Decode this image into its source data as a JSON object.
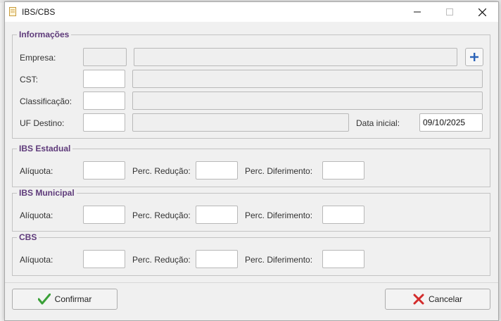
{
  "window": {
    "title": "IBS/CBS"
  },
  "informacoes": {
    "legend": "Informações",
    "empresa_label": "Empresa:",
    "empresa_code": "",
    "empresa_name": "",
    "cst_label": "CST:",
    "cst_code": "",
    "cst_desc": "",
    "classificacao_label": "Classificação:",
    "classificacao_code": "",
    "classificacao_desc": "",
    "uf_label": "UF Destino:",
    "uf_code": "",
    "uf_desc": "",
    "data_inicial_label": "Data inicial:",
    "data_inicial_value": "09/10/2025"
  },
  "ibs_estadual": {
    "legend": "IBS Estadual",
    "aliquota_label": "Alíquota:",
    "aliquota_value": "",
    "reducao_label": "Perc. Redução:",
    "reducao_value": "",
    "diferimento_label": "Perc. Diferimento:",
    "diferimento_value": ""
  },
  "ibs_municipal": {
    "legend": "IBS Municipal",
    "aliquota_label": "Alíquota:",
    "aliquota_value": "",
    "reducao_label": "Perc. Redução:",
    "reducao_value": "",
    "diferimento_label": "Perc. Diferimento:",
    "diferimento_value": ""
  },
  "cbs": {
    "legend": "CBS",
    "aliquota_label": "Alíquota:",
    "aliquota_value": "",
    "reducao_label": "Perc. Redução:",
    "reducao_value": "",
    "diferimento_label": "Perc. Diferimento:",
    "diferimento_value": ""
  },
  "buttons": {
    "confirmar": "Confirmar",
    "cancelar": "Cancelar"
  },
  "icons": {
    "title": "document-icon",
    "add": "plus-icon",
    "confirm": "checkmark-icon",
    "cancel": "x-icon"
  },
  "colors": {
    "legend": "#5e3a7a",
    "plus": "#2b63b8",
    "check": "#3aa038",
    "cancel": "#d32b2b"
  }
}
